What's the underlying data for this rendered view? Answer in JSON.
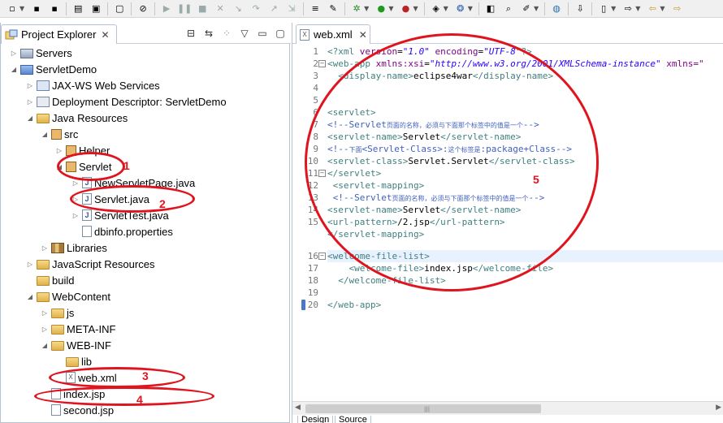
{
  "toolbar": {
    "buttons": [
      "new-file-icon",
      "save-icon",
      "save-all-icon",
      "print-icon",
      "build-icon",
      "open-type-icon",
      "debug-skip-icon",
      "resume-icon",
      "suspend-icon",
      "terminate-icon",
      "disconnect-icon",
      "step-into-icon",
      "step-over-icon",
      "step-return-icon",
      "drop-to-frame-icon",
      "use-step-filters-icon",
      "debug-icon",
      "run-icon",
      "external-tools-icon",
      "new-server-icon",
      "web-service-icon",
      "open-task-icon",
      "search-icon",
      "annotation-icon",
      "globe-icon",
      "back-icon",
      "forward-icon"
    ]
  },
  "explorer": {
    "tab_title": "Project Explorer",
    "close_glyph": "✕",
    "tree": [
      {
        "label": "Servers",
        "icon": "folder"
      },
      {
        "label": "ServletDemo",
        "icon": "project"
      },
      {
        "label": "JAX-WS Web Services",
        "icon": "jax"
      },
      {
        "label": "Deployment Descriptor: ServletDemo",
        "icon": "dd"
      },
      {
        "label": "Java Resources",
        "icon": "folder"
      },
      {
        "label": "src",
        "icon": "pkg"
      },
      {
        "label": "Helper",
        "icon": "pkg"
      },
      {
        "label": "Servlet",
        "icon": "pkg"
      },
      {
        "label": "NewServletPage.java",
        "icon": "java"
      },
      {
        "label": "Servlet.java",
        "icon": "java"
      },
      {
        "label": "ServletTest.java",
        "icon": "java"
      },
      {
        "label": "dbinfo.properties",
        "icon": "file"
      },
      {
        "label": "Libraries",
        "icon": "lib"
      },
      {
        "label": "JavaScript Resources",
        "icon": "folder"
      },
      {
        "label": "build",
        "icon": "folder"
      },
      {
        "label": "WebContent",
        "icon": "folder"
      },
      {
        "label": "js",
        "icon": "folder"
      },
      {
        "label": "META-INF",
        "icon": "folder"
      },
      {
        "label": "WEB-INF",
        "icon": "folder"
      },
      {
        "label": "lib",
        "icon": "folder"
      },
      {
        "label": "web.xml",
        "icon": "xml"
      },
      {
        "label": "index.jsp",
        "icon": "file"
      },
      {
        "label": "second.jsp",
        "icon": "file"
      }
    ]
  },
  "editor": {
    "tab_title": "web.xml",
    "close_glyph": "✕",
    "line_numbers": [
      "1",
      "2",
      "3",
      "4",
      "5",
      "6",
      "7",
      "8",
      "9",
      "10",
      "11",
      "12",
      "13",
      "14",
      "15",
      "16",
      "17",
      "18",
      "19",
      "20"
    ],
    "lines": {
      "l1_a": "<?xml ",
      "l1_b": "version",
      "l1_c": "=",
      "l1_d": "\"1.0\"",
      "l1_e": " encoding",
      "l1_f": "=",
      "l1_g": "\"UTF-8\"",
      "l1_h": "?>",
      "l2_a": "<web-app ",
      "l2_b": "xmlns:xsi",
      "l2_c": "=",
      "l2_d": "\"http://www.w3.org/2001/XMLSchema-instance\"",
      "l2_e": " xmlns=\"",
      "l3_a": "  <display-name>",
      "l3_b": "eclipse4war",
      "l3_c": "</display-name>",
      "l6": "<servlet>",
      "l7_a": "<!--Servlet",
      "l7_b": "页面的名称，必须与下面那个标签中的值是一个",
      "l7_c": "-->",
      "l8_a": "<servlet-name>",
      "l8_b": "Servlet",
      "l8_c": "</servlet-name>",
      "l9_a": "<!--",
      "l9_b": "下面",
      "l9_c": "<Servlet-Class>:",
      "l9_d": "这个标签是",
      "l9_e": ":package+Class-->",
      "l10_a": "<servlet-class>",
      "l10_b": "Servlet.Servlet",
      "l10_c": "</servlet-class>",
      "l11": "</servlet>",
      "l12": " <servlet-mapping>",
      "l13_a": " <!--Servlet",
      "l13_b": "页面的名称，必须与下面那个标签中的值是一个",
      "l13_c": "-->",
      "l14_a": "<servlet-name>",
      "l14_b": "Servlet",
      "l14_c": "</servlet-name>",
      "l15_a": "<url-pattern>",
      "l15_b": "/2.jsp",
      "l15_c": "</url-pattern>",
      "l16": "</servlet-mapping>",
      "l17": "<welcome-file-list>",
      "l18_a": "    <welcome-file>",
      "l18_b": "index.jsp",
      "l18_c": "</welcome-file>",
      "l19": "  </welcome-file-list>",
      "l21": "</web-app>"
    },
    "bottom_tabs": [
      "Design",
      "Source"
    ]
  },
  "annotations": {
    "n1": "1",
    "n2": "2",
    "n3": "3",
    "n4": "4",
    "n5": "5",
    "color": "#e0141e"
  }
}
